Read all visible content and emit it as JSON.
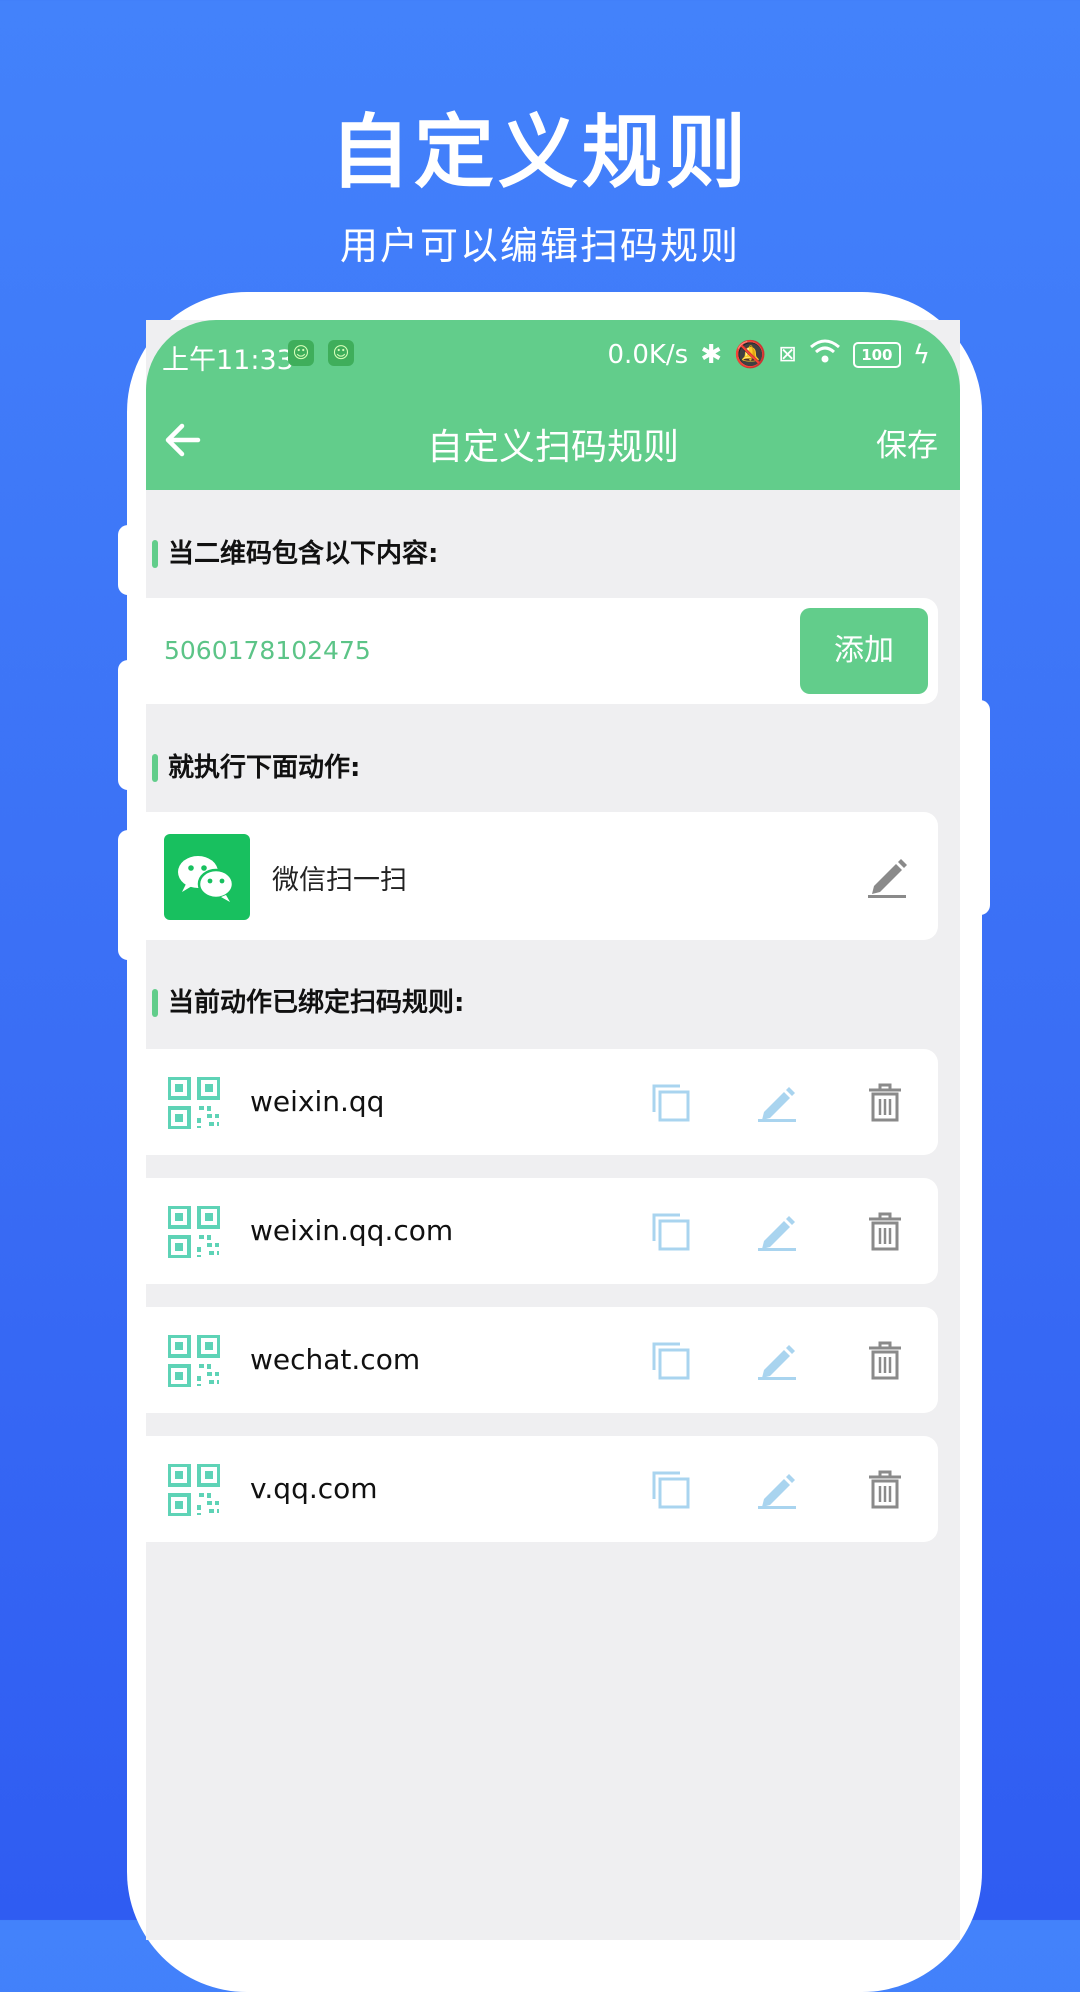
{
  "promo": {
    "title": "自定义规则",
    "subtitle": "用户可以编辑扫码规则"
  },
  "status_bar": {
    "time": "上午11:33",
    "network_speed": "0.0K/s",
    "battery": "100"
  },
  "toolbar": {
    "title": "自定义扫码规则",
    "save_label": "保存"
  },
  "condition": {
    "section_label": "当二维码包含以下内容:",
    "input_value": "5060178102475",
    "add_label": "添加"
  },
  "action": {
    "section_label": "就执行下面动作:",
    "name": "微信扫一扫"
  },
  "rules": {
    "section_label": "当前动作已绑定扫码规则:",
    "items": [
      {
        "text": "weixin.qq"
      },
      {
        "text": "weixin.qq.com"
      },
      {
        "text": "wechat.com"
      },
      {
        "text": "v.qq.com"
      }
    ]
  },
  "colors": {
    "accent_green": "#62cd8b",
    "wechat_green": "#18c05f",
    "qr_teal": "#5ed3b6",
    "icon_blue": "#a9d4ef",
    "icon_gray": "#8a8a8a",
    "background_blue": "#3a6ef5"
  }
}
